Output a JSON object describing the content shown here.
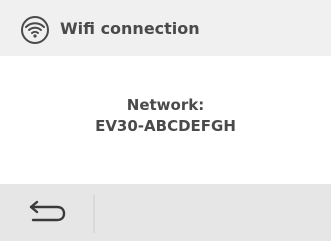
{
  "header": {
    "icon": "wifi-icon",
    "title": "Wifi connection"
  },
  "network": {
    "label": "Network:",
    "value": "EV30-ABCDEFGH"
  },
  "footer": {
    "back_icon": "back-arrow-icon"
  },
  "colors": {
    "header_bg": "#f0f0f0",
    "footer_bg": "#e6e6e6",
    "text": "#4a4a4a"
  }
}
